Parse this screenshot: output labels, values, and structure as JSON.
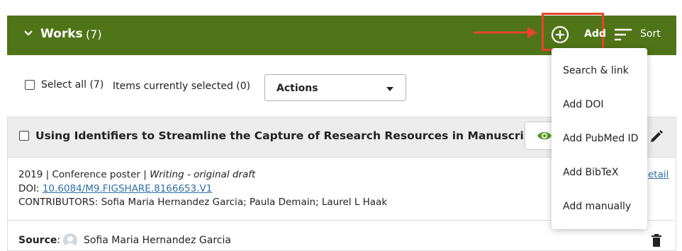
{
  "header": {
    "title": "Works",
    "count": "(7)",
    "add_label": "Add",
    "sort_label": "Sort"
  },
  "toolbar": {
    "select_all_label": "Select all (7)",
    "items_selected_label": "Items currently selected (0)",
    "actions_label": "Actions"
  },
  "add_menu": {
    "items": [
      "Search & link",
      "Add DOI",
      "Add PubMed ID",
      "Add BibTeX",
      "Add manually"
    ]
  },
  "work": {
    "title": "Using Identifiers to Streamline the Capture of Research Resources in Manuscripts",
    "year_type_prefix": "2019 | Conference poster | ",
    "role": "Writing - original draft",
    "doi_label": "DOI: ",
    "doi_value": "10.6084/M9.FIGSHARE.8166653.V1",
    "contributors": "CONTRIBUTORS: Sofia Maria Hernandez Garcia; Paula Demain; Laurel L Haak",
    "detail_link": "etail",
    "source_label": "Source",
    "source_colon": ":",
    "source_name": "Sofia Maria Hernandez Garcia"
  },
  "colors": {
    "header_bg": "#4f7518",
    "highlight": "#e8442a",
    "link": "#2d6fa6",
    "eye": "#4f9a1c"
  },
  "icons": [
    "chevron-down-icon",
    "add-circle-icon",
    "sort-icon",
    "arrow-right-icon",
    "caret-down-icon",
    "eye-icon",
    "pencil-icon",
    "avatar-icon",
    "trash-icon"
  ]
}
